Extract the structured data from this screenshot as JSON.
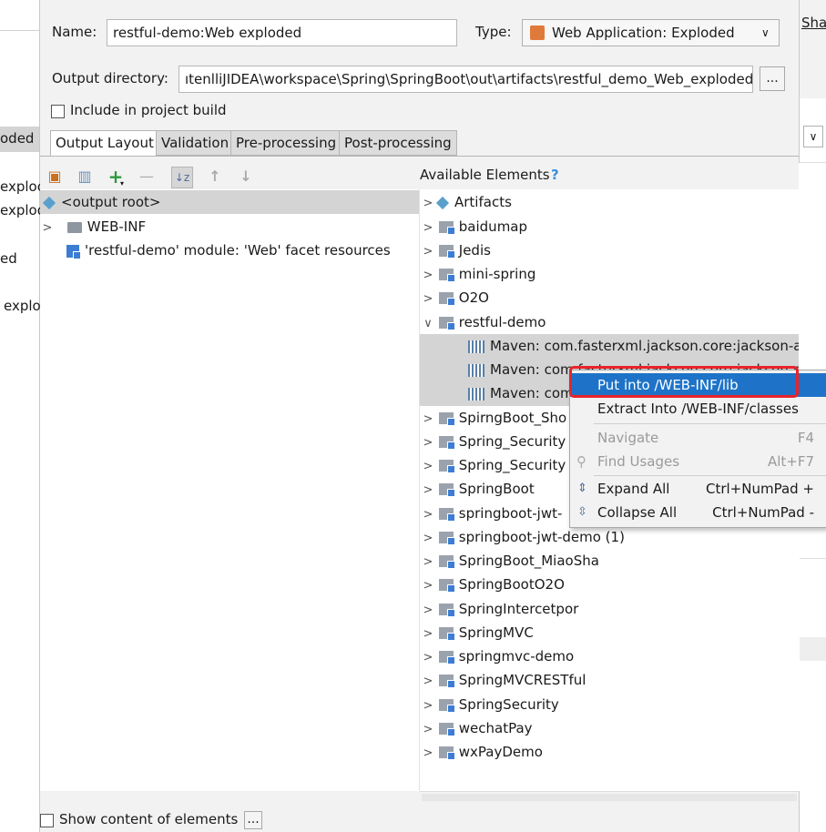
{
  "background_fragments": {
    "left": [
      "oded",
      "exploc",
      "explod",
      "ed",
      "explo"
    ],
    "right_header": "Shar"
  },
  "name_label": "Name:",
  "name_value": "restful-demo:Web exploded",
  "type_label": "Type:",
  "type_value": "Web Application: Exploded",
  "output_dir_label": "Output directory:",
  "output_dir_value": "ıtenlliJIDEA\\workspace\\Spring\\SpringBoot\\out\\artifacts\\restful_demo_Web_exploded",
  "browse_label": "...",
  "include_label": "Include in project build",
  "tabs": [
    "Output Layout",
    "Validation",
    "Pre-processing",
    "Post-processing"
  ],
  "toolbar": {
    "add": "+",
    "remove": "—",
    "up": "↑",
    "down": "↓",
    "sort": "↓z"
  },
  "layout_tree": [
    {
      "label": "<output root>",
      "icon": "diamond",
      "selected": true
    },
    {
      "label": "WEB-INF",
      "icon": "folder",
      "expand": true
    },
    {
      "label": "'restful-demo' module: 'Web' facet resources",
      "icon": "module-web"
    }
  ],
  "available_title": "Available Elements",
  "available_help": "?",
  "available_tree": [
    {
      "label": "Artifacts",
      "icon": "diamond"
    },
    {
      "label": "baidumap"
    },
    {
      "label": "Jedis"
    },
    {
      "label": "mini-spring"
    },
    {
      "label": "O2O"
    },
    {
      "label": "restful-demo",
      "expanded": true
    },
    {
      "label": "Maven: com.fasterxml.jackson.core:jackson-ann",
      "child": true
    },
    {
      "label": "Maven: com.fasterxml.jackson.core:jackson-co",
      "child": true
    },
    {
      "label": "Maven: com.fasterxml.jackson.core:jackson-da",
      "child": true
    },
    {
      "label": "SpirngBoot_Sho"
    },
    {
      "label": "Spring_Security"
    },
    {
      "label": "Spring_Security"
    },
    {
      "label": "SpringBoot"
    },
    {
      "label": "springboot-jwt-"
    },
    {
      "label": "springboot-jwt-demo (1)"
    },
    {
      "label": "SpringBoot_MiaoSha"
    },
    {
      "label": "SpringBootO2O"
    },
    {
      "label": "SpringIntercetpor"
    },
    {
      "label": "SpringMVC"
    },
    {
      "label": "springmvc-demo"
    },
    {
      "label": "SpringMVCRESTful"
    },
    {
      "label": "SpringSecurity"
    },
    {
      "label": "wechatPay"
    },
    {
      "label": "wxPayDemo"
    }
  ],
  "context_menu": [
    {
      "label": "Put into /WEB-INF/lib",
      "shortcut": "",
      "highlighted": true
    },
    {
      "label": "Extract Into /WEB-INF/classes",
      "shortcut": ""
    },
    {
      "label": "Navigate",
      "shortcut": "F4",
      "disabled": true
    },
    {
      "label": "Find Usages",
      "shortcut": "Alt+F7",
      "disabled": true
    },
    {
      "label": "Expand All",
      "shortcut": "Ctrl+NumPad +"
    },
    {
      "label": "Collapse All",
      "shortcut": "Ctrl+NumPad -"
    }
  ],
  "show_content_label": "Show content of elements",
  "show_content_btn": "...",
  "colors": {
    "selection": "#1e73c8",
    "highlight_box": "#e8242a",
    "help": "#3c8fd6"
  }
}
